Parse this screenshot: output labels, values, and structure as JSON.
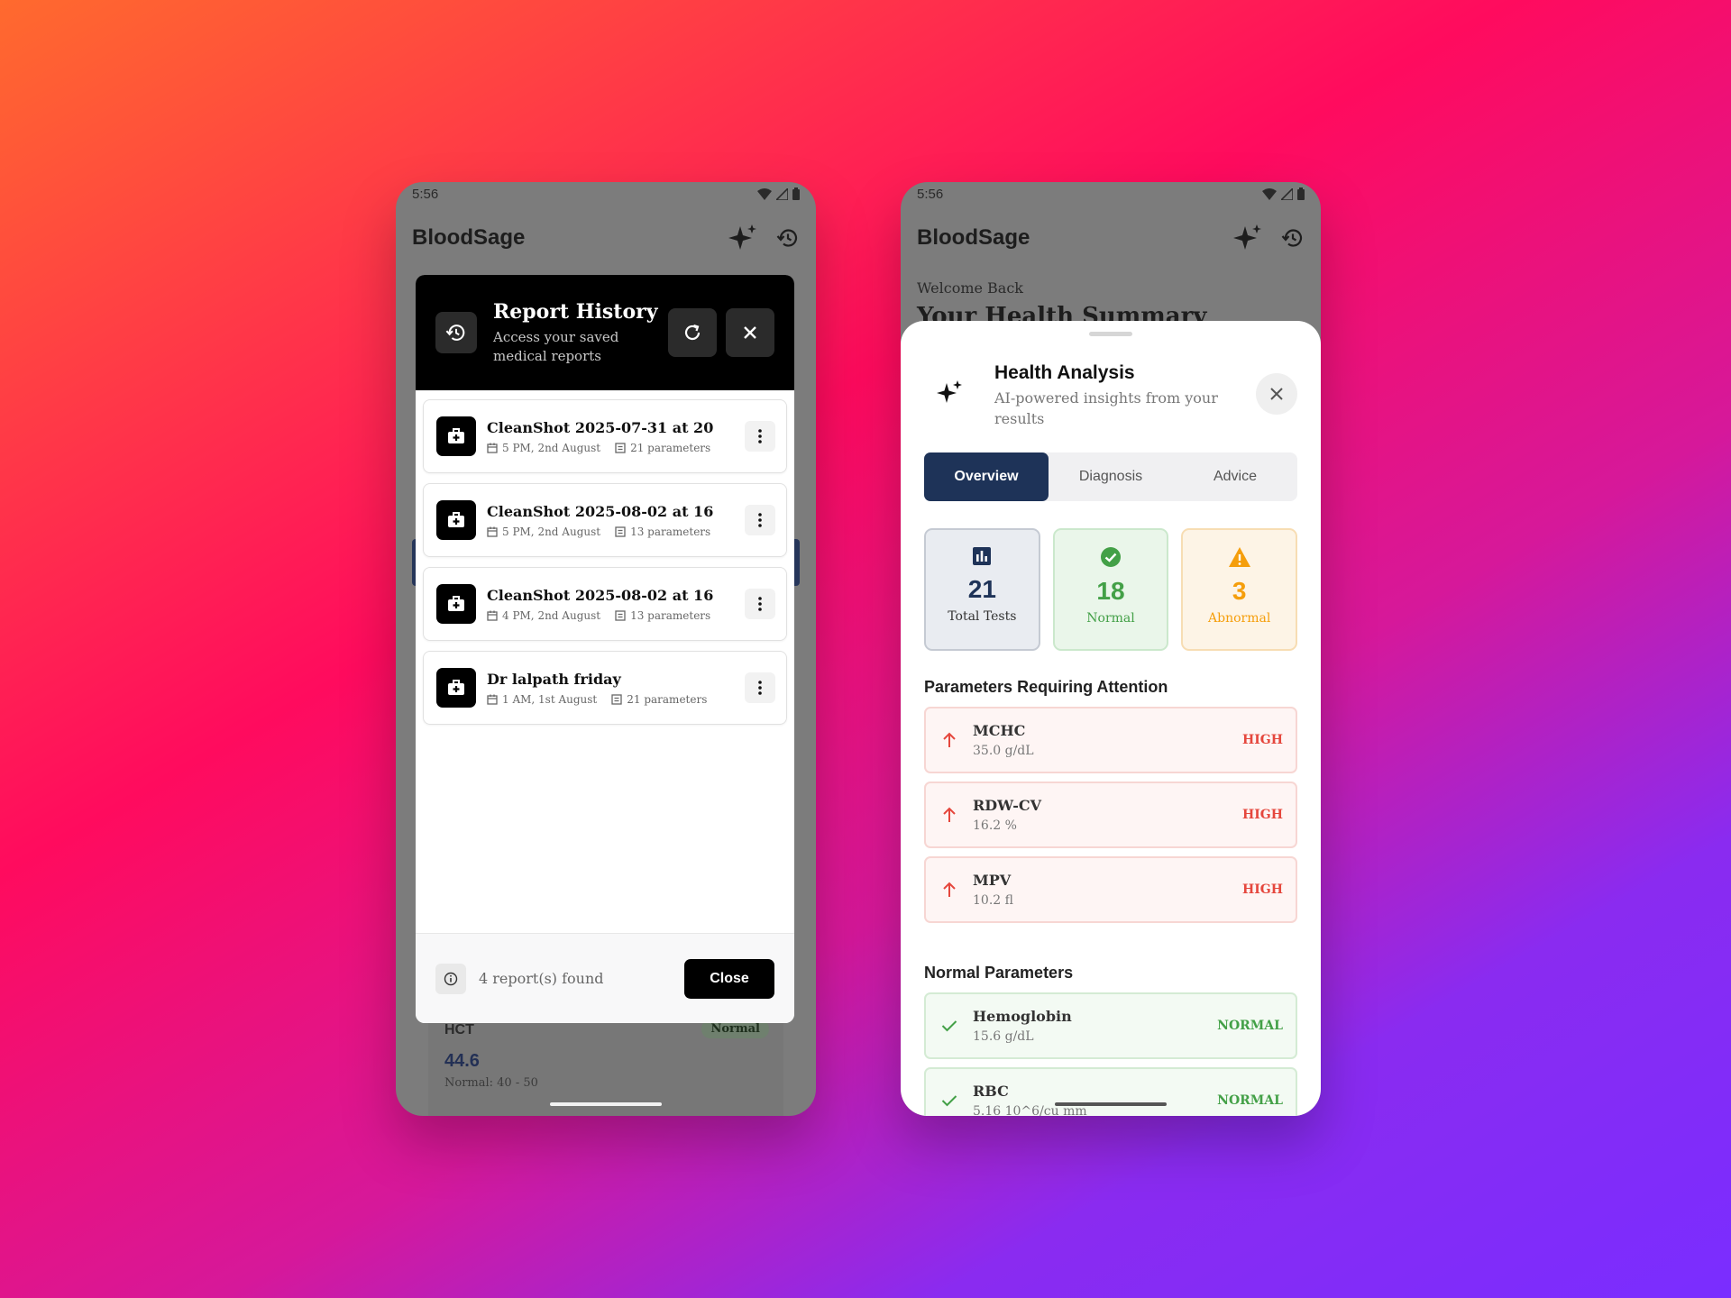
{
  "left_phone": {
    "status_time": "5:56",
    "app_title": "BloodSage",
    "background": {
      "hct_label": "HCT",
      "hct_badge": "Normal",
      "hct_value": "44.6",
      "hct_range": "Normal: 40 - 50"
    },
    "modal": {
      "title": "Report History",
      "subtitle": "Access your saved medical reports",
      "reports": [
        {
          "name": "CleanShot 2025-07-31 at 20",
          "date": "5 PM, 2nd August",
          "params": "21 parameters"
        },
        {
          "name": "CleanShot 2025-08-02 at 16",
          "date": "5 PM, 2nd August",
          "params": "13 parameters"
        },
        {
          "name": "CleanShot 2025-08-02 at 16",
          "date": "4 PM, 2nd August",
          "params": "13 parameters"
        },
        {
          "name": "Dr lalpath friday",
          "date": "1 AM, 1st August",
          "params": "21 parameters"
        }
      ],
      "footer_count": "4 report(s) found",
      "close_label": "Close"
    }
  },
  "right_phone": {
    "status_time": "5:56",
    "app_title": "BloodSage",
    "welcome": "Welcome Back",
    "summary_title": "Your Health Summary",
    "sheet": {
      "title": "Health Analysis",
      "subtitle": "AI-powered insights from your results",
      "tabs": [
        "Overview",
        "Diagnosis",
        "Advice"
      ],
      "stats": [
        {
          "value": "21",
          "label": "Total Tests"
        },
        {
          "value": "18",
          "label": "Normal"
        },
        {
          "value": "3",
          "label": "Abnormal"
        }
      ],
      "attention_title": "Parameters Requiring Attention",
      "attention": [
        {
          "name": "MCHC",
          "value": "35.0 g/dL",
          "status": "HIGH"
        },
        {
          "name": "RDW-CV",
          "value": "16.2 %",
          "status": "HIGH"
        },
        {
          "name": "MPV",
          "value": "10.2 fl",
          "status": "HIGH"
        }
      ],
      "normal_title": "Normal Parameters",
      "normal": [
        {
          "name": "Hemoglobin",
          "value": "15.6 g/dL",
          "status": "NORMAL"
        },
        {
          "name": "RBC",
          "value": "5.16 10^6/cu mm",
          "status": "NORMAL"
        }
      ]
    }
  },
  "colors": {
    "navy": "#1e3358",
    "high": "#e5473d",
    "normal": "#43a047",
    "abnormal": "#f59e0b"
  },
  "icons": [
    "history-icon",
    "sparkle-icon",
    "refresh-icon",
    "close-icon",
    "medical-bag-icon",
    "calendar-icon",
    "list-icon",
    "more-vertical-icon",
    "info-icon",
    "bar-chart-icon",
    "check-circle-icon",
    "warning-icon",
    "arrow-up-icon",
    "check-icon",
    "wifi-icon",
    "signal-icon",
    "battery-icon"
  ]
}
